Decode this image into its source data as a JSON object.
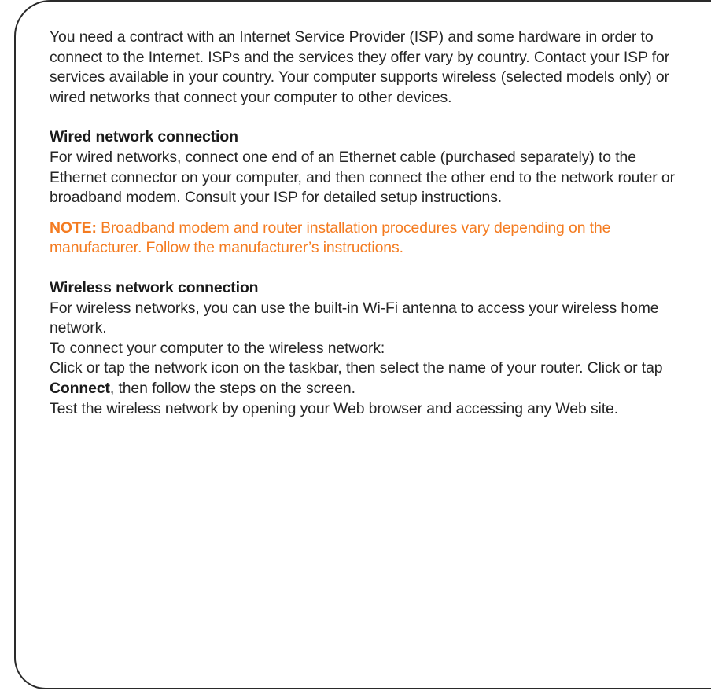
{
  "intro": "You need a contract with an Internet Service Provider (ISP) and some hardware in order to connect to the Internet. ISPs and the services they offer vary by country. Contact your ISP for services available in your country. Your computer supports wireless (selected models only) or wired networks that connect your computer to other devices.",
  "wired": {
    "heading": "Wired network connection",
    "body": "For wired networks, connect one end of an Ethernet cable (purchased separately) to the Ethernet connector on your computer, and then connect the other end to the network router or broadband modem. Consult your ISP for detailed setup instructions."
  },
  "note": {
    "label": "NOTE:",
    "text": " Broadband modem and router installation procedures vary depending on the manufacturer. Follow the manufacturer’s instructions."
  },
  "wireless": {
    "heading": "Wireless network connection",
    "body": "For wireless networks, you can use the built-in Wi-Fi antenna to access your wireless home network.",
    "steps_intro": "To connect your computer to the wireless network:",
    "step_before": "Click or tap the network icon on the taskbar, then select the name of your router. Click or tap ",
    "step_bold": "Connect",
    "step_after": ", then follow the steps on the screen.",
    "test": "Test the wireless network by opening your Web browser and accessing any Web site."
  },
  "colors": {
    "note": "#f47b20",
    "text": "#262626",
    "border": "#2a2a2a"
  }
}
